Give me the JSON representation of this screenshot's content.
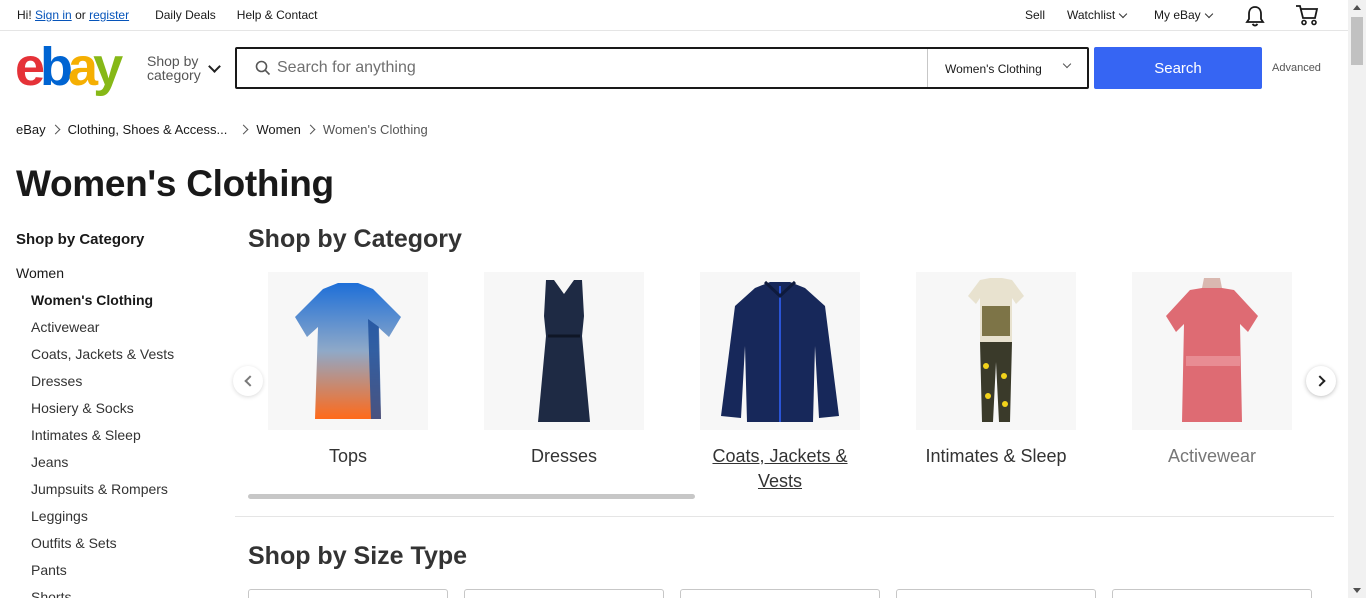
{
  "topbar": {
    "greeting": "Hi!",
    "sign_in": "Sign in",
    "or": "or",
    "register": "register",
    "daily_deals": "Daily Deals",
    "help_contact": "Help & Contact",
    "sell": "Sell",
    "watchlist": "Watchlist",
    "my_ebay": "My eBay"
  },
  "header": {
    "logo_letters": [
      "e",
      "b",
      "a",
      "y"
    ],
    "shop_by_line1": "Shop by",
    "shop_by_line2": "category",
    "search_placeholder": "Search for anything",
    "search_category": "Women's Clothing",
    "search_button": "Search",
    "advanced": "Advanced"
  },
  "breadcrumb": [
    "eBay",
    "Clothing, Shoes & Access...",
    "Women",
    "Women's Clothing"
  ],
  "page_title": "Women's Clothing",
  "sidebar": {
    "heading": "Shop by Category",
    "parent": "Women",
    "items": [
      "Women's Clothing",
      "Activewear",
      "Coats, Jackets & Vests",
      "Dresses",
      "Hosiery & Socks",
      "Intimates & Sleep",
      "Jeans",
      "Jumpsuits & Rompers",
      "Leggings",
      "Outfits & Sets",
      "Pants",
      "Shorts"
    ],
    "active_index": 0
  },
  "main": {
    "shop_by_category_title": "Shop by Category",
    "categories": [
      {
        "label": "Tops",
        "icon": "tshirt-icon"
      },
      {
        "label": "Dresses",
        "icon": "dress-icon"
      },
      {
        "label": "Coats, Jackets & Vests",
        "icon": "jacket-icon"
      },
      {
        "label": "Intimates & Sleep",
        "icon": "pajamas-icon"
      },
      {
        "label": "Activewear",
        "icon": "top-icon"
      }
    ],
    "shop_by_size_title": "Shop by Size Type"
  },
  "colors": {
    "search_button": "#3665f3",
    "link": "#0654ba",
    "logo_e": "#e53238",
    "logo_b": "#0064d2",
    "logo_a": "#f5af02",
    "logo_y": "#86b817"
  }
}
